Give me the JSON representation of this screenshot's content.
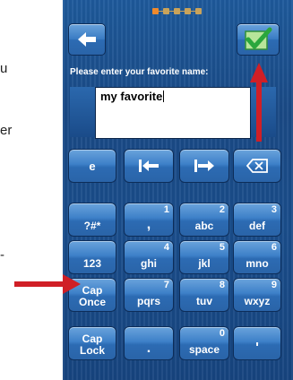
{
  "edge_text": [
    "u",
    "er",
    "-"
  ],
  "status": {
    "page_dots": 5,
    "active_dot": 1
  },
  "toolbar": {
    "back_icon": "arrow-left-icon",
    "confirm_icon": "green-checkmark-icon",
    "confirm_color": "#3db54a"
  },
  "prompt": {
    "text": "Please enter your favorite name:"
  },
  "input": {
    "value": "my favorite"
  },
  "edit_row": [
    {
      "label": "e"
    },
    {
      "icon": "cursor-left-icon"
    },
    {
      "icon": "cursor-right-icon"
    },
    {
      "icon": "backspace-icon"
    }
  ],
  "keys": [
    {
      "label": "?#*",
      "num": ""
    },
    {
      "label": ",",
      "num": "1"
    },
    {
      "label": "abc",
      "num": "2"
    },
    {
      "label": "def",
      "num": "3"
    },
    {
      "label": "123",
      "num": ""
    },
    {
      "label": "ghi",
      "num": "4"
    },
    {
      "label": "jkl",
      "num": "5"
    },
    {
      "label": "mno",
      "num": "6"
    },
    {
      "label": "Cap Once",
      "num": ""
    },
    {
      "label": "pqrs",
      "num": "7"
    },
    {
      "label": "tuv",
      "num": "8"
    },
    {
      "label": "wxyz",
      "num": "9"
    },
    {
      "label": "Cap Lock",
      "num": ""
    },
    {
      "label": ".",
      "num": ""
    },
    {
      "label": "space",
      "num": "0"
    },
    {
      "label": "'",
      "num": ""
    }
  ],
  "annotation_color": "#d01f26"
}
